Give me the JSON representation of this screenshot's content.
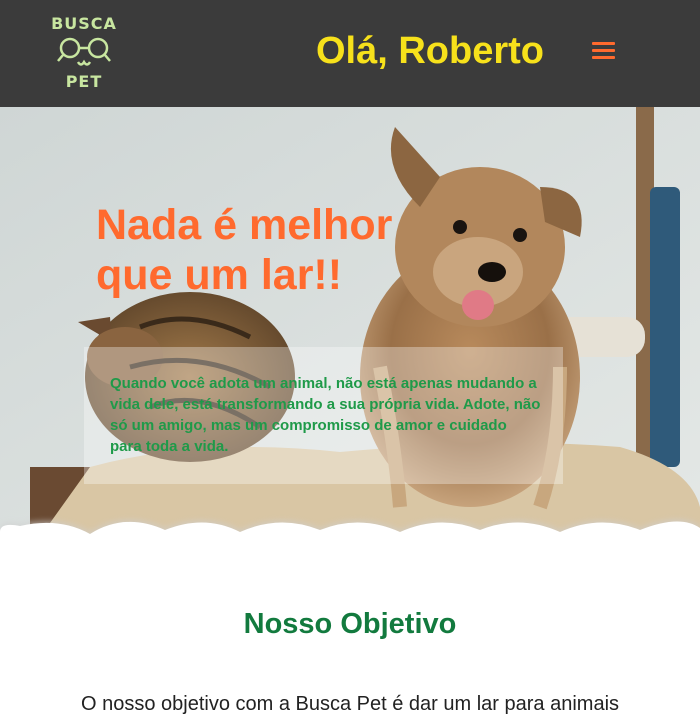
{
  "header": {
    "logo": {
      "top": "BUSCA",
      "bottom": "PET",
      "icon": "magnifier-glasses-icon"
    },
    "greeting": "Olá, Roberto",
    "menu_icon": "hamburger-menu-icon"
  },
  "hero": {
    "title_line1": "Nada é melhor",
    "title_line2": "que um lar!!",
    "text": "Quando você adota um animal, não está apenas mudando a vida dele, está transformando a sua própria vida. Adote, não só um amigo, mas um compromisso de amor e cuidado para toda a vida."
  },
  "objective": {
    "title": "Nosso Objetivo",
    "text": "O nosso objetivo com a Busca Pet é dar um lar para animais"
  },
  "colors": {
    "header_bg": "#3b3b3b",
    "greeting": "#f7e11b",
    "accent_orange": "#ff6a2e",
    "green": "#1f9a49",
    "section_title": "#127a3e"
  }
}
